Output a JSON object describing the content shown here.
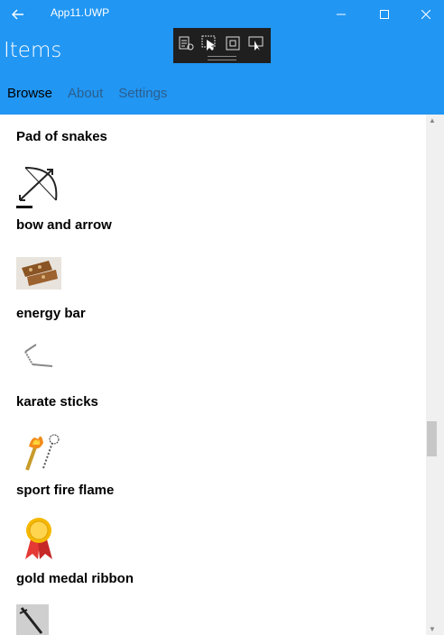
{
  "window": {
    "title": "App11.UWP"
  },
  "header": {
    "title": "Items"
  },
  "tabs": [
    {
      "label": "Browse"
    },
    {
      "label": "About"
    },
    {
      "label": "Settings"
    }
  ],
  "items": [
    {
      "label": "Pad of snakes",
      "icon": "snake-pad-image"
    },
    {
      "label": "bow and arrow",
      "icon": "bow-and-arrow-image"
    },
    {
      "label": "energy bar",
      "icon": "energy-bar-image"
    },
    {
      "label": "karate sticks",
      "icon": "karate-sticks-image"
    },
    {
      "label": "sport fire flame",
      "icon": "fire-torch-image"
    },
    {
      "label": "gold medal ribbon",
      "icon": "gold-medal-image"
    },
    {
      "label": "",
      "icon": "sword-image"
    }
  ],
  "colors": {
    "accent": "#2196f3",
    "titlebar_text": "#ffffff"
  }
}
